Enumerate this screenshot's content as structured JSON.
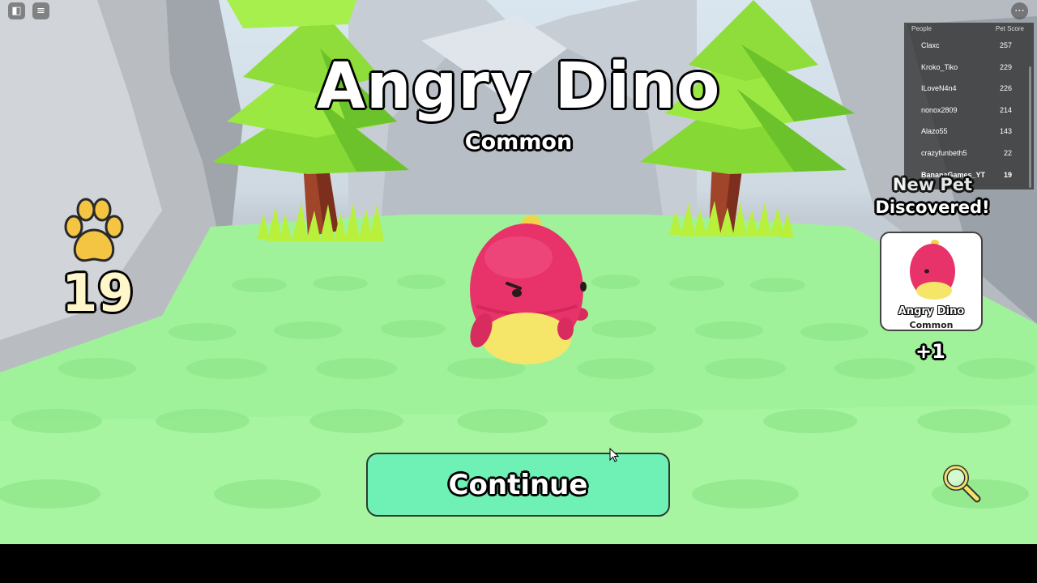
{
  "pet_reveal": {
    "pet_name": "Angry Dino",
    "rarity": "Common",
    "continue_label": "Continue"
  },
  "hud": {
    "paw_count": "19",
    "new_pet_title_line1": "New Pet",
    "new_pet_title_line2": "Discovered!",
    "new_pet_card_name": "Angry Dino",
    "new_pet_card_rarity": "Common",
    "new_pet_delta": "+1"
  },
  "leaderboard": {
    "col_people": "People",
    "col_score": "Pet Score",
    "rows": [
      {
        "name": "Claxc",
        "score": "257"
      },
      {
        "name": "Kroko_Tiko",
        "score": "229"
      },
      {
        "name": "ILoveN4n4",
        "score": "226"
      },
      {
        "name": "nonox2809",
        "score": "214"
      },
      {
        "name": "Alazo55",
        "score": "143"
      },
      {
        "name": "crazyfunbeth5",
        "score": "22"
      },
      {
        "name": "BananaGames_YT",
        "score": "19"
      }
    ]
  },
  "icons": {
    "roblox_menu": "roblox-logo-icon",
    "chat": "chat-icon",
    "more": "more-options-icon",
    "paw": "paw-icon",
    "search": "magnifier-icon"
  },
  "colors": {
    "grass": "#9ff29a",
    "continue_button": "#6ff0b4",
    "dino_body": "#e8336a",
    "dino_belly": "#f5e66a",
    "paw": "#f4c542",
    "tree_green": "#8fe03a"
  }
}
